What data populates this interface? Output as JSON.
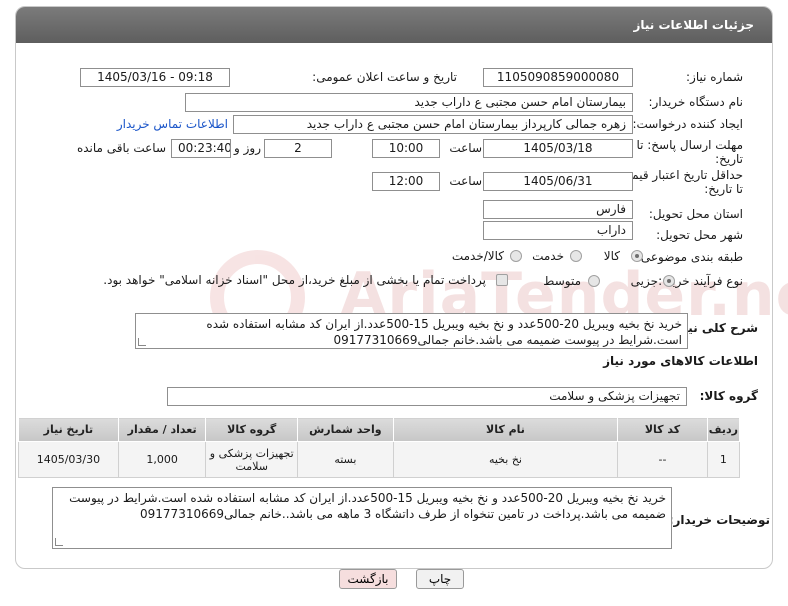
{
  "header": {
    "title": "جزئیات اطلاعات نیاز"
  },
  "watermark": {
    "brand": "AriaTender.neT"
  },
  "fields": {
    "need_number_label": "شماره نیاز:",
    "need_number": "1105090859000080",
    "announce_label": "تاریخ و ساعت اعلان عمومی:",
    "announce_value": "1405/03/16 - 09:18",
    "buyer_org_label": "نام دستگاه خریدار:",
    "buyer_org": "بیمارستان امام حسن مجتبی  ع  داراب جدید",
    "creator_label": "ایجاد کننده درخواست:",
    "creator": "زهره جمالی کارپرداز بیمارستان امام حسن مجتبی  ع  داراب جدید",
    "contact_link": "اطلاعات تماس خریدار",
    "deadline_label_1": "مهلت ارسال پاسخ: تا",
    "deadline_label_2": "تاریخ:",
    "deadline_date": "1405/03/18",
    "time_label": "ساعت",
    "deadline_time": "10:00",
    "days_value": "2",
    "days_label": "روز و",
    "remaining_time": "00:23:40",
    "remaining_label": "ساعت باقی مانده",
    "validity_label_1": "حداقل تاریخ اعتبار قیمت:",
    "validity_label_2": "تا تاریخ:",
    "validity_date": "1405/06/31",
    "validity_time": "12:00",
    "province_label": "استان محل تحویل:",
    "province": "فارس",
    "city_label": "شهر محل تحویل:",
    "city": "داراب",
    "category_label": "طبقه بندی موضوعی:",
    "category_options": [
      "کالا",
      "خدمت",
      "کالا/خدمت"
    ],
    "category_selected": "کالا",
    "process_label": "نوع فرآیند خرید :",
    "process_options": [
      "جزیی",
      "متوسط"
    ],
    "process_selected": "جزیی",
    "payment_note": "پرداخت تمام یا بخشی از مبلغ خرید،از محل \"اسناد خزانه اسلامی\" خواهد بود.",
    "description_label": "شرح کلی نیاز:",
    "description": "خرید نخ بخیه ویبریل 20-500عدد و نخ بخیه ویبریل 15-500عدد.از ایران کد مشابه استفاده شده است.شرایط در پیوست ضمیمه می باشد.خانم جمالی09177310669"
  },
  "items_section": {
    "title": "اطلاعات کالاهای مورد نیاز",
    "group_label": "گروه کالا:",
    "group_value": "تجهیزات پزشکی و سلامت",
    "columns": [
      "ردیف",
      "کد کالا",
      "نام کالا",
      "واحد شمارش",
      "گروه کالا",
      "تعداد / مقدار",
      "تاریخ نیاز"
    ],
    "rows": [
      {
        "index": "1",
        "code": "--",
        "name": "نخ بخیه",
        "unit": "بسته",
        "group": "تجهیزات پزشکی و سلامت",
        "qty": "1,000",
        "date": "1405/03/30"
      }
    ]
  },
  "buyer_notes": {
    "label": "توضیحات خریدار:",
    "text": "خرید نخ بخیه ویبریل 20-500عدد و نخ بخیه ویبریل 15-500عدد.از ایران کد مشابه استفاده شده است.شرایط در پیوست ضمیمه می باشد.پرداخت در تامین تنخواه از طرف داتشگاه 3 ماهه می باشد..خانم جمالی09177310669"
  },
  "buttons": {
    "print": "چاپ",
    "back": "بازگشت"
  },
  "colors": {
    "header": "#6b6b6b",
    "link": "#1a55c9",
    "back_button": "#f6dede"
  }
}
